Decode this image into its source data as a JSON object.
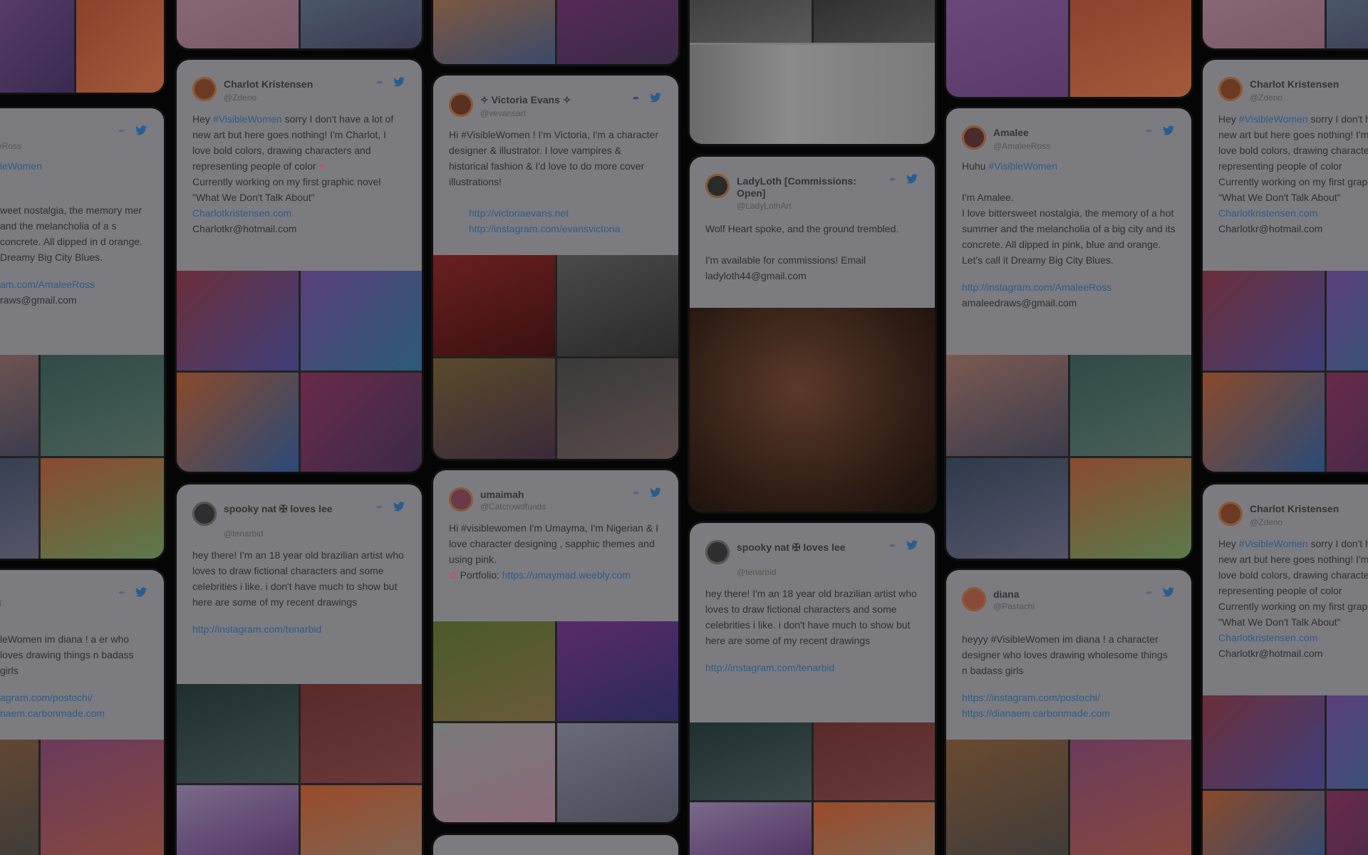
{
  "cards": {
    "charlot": {
      "name": "Charlot Kristensen",
      "handle": "@Zdeno",
      "lines": [
        "Hey",
        "#VisibleWomen",
        "sorry I don't have a lot of new art but here goes nothing! I'm Charlot, I love bold colors, drawing characters and representing people of color",
        "Currently working on my first graphic novel \"What We Don't Talk About\""
      ],
      "link": "Charlotkristensen.com",
      "email": "Charlotkr@hotmail.com"
    },
    "victoria": {
      "name": "✧ Victoria Evans ✧",
      "handle": "@vevansart",
      "text": "Hi #VisibleWomen ! I'm Victoria, I'm a character designer & illustrator. I love vampires & historical fashion & I'd love to do more cover illustrations!",
      "link1": "http://victoriaevans.net",
      "link2": "http://instagram.com/evansvictoria"
    },
    "ladyloth": {
      "name": "LadyLoth [Commissions: Open]",
      "handle": "@LadyLothArt",
      "text1": "Wolf Heart spoke, and the ground trembled.",
      "text2": "I'm available for commissions! Email ladyloth44@gmail.com"
    },
    "amalee": {
      "name": "Amalee",
      "handle": "@AmaleeRoss",
      "greeting": "Huhu",
      "tag": "#VisibleWomen",
      "intro": "I'm Amalee.",
      "text": "I love bittersweet nostalgia, the memory of a hot summer and the melancholia of a big city and its concrete. All dipped in pink, blue and orange. Let's call it Dreamy Big City Blues.",
      "link": "http://instagram.com/AmaleeRoss",
      "email": "amaleedraws@gmail.com"
    },
    "spooky": {
      "name": "spooky nat ✠ loves lee",
      "handle": "@tenarbid",
      "text": "hey there! I'm an 18 year old brazilian artist who loves to draw fictional characters and some celebrities i like. i don't have much to show but here are some of my recent drawings",
      "link": "http://instagram.com/tenarbid"
    },
    "umaimah": {
      "name": "umaimah",
      "handle": "@Catcrowdfunds",
      "text": "Hi #visiblewomen I'm Umayma, I'm Nigerian & I love character designing , sapphic themes and using pink.",
      "portfolio_label": "Portfolio:",
      "portfolio": "https://umaymad.weebly.com"
    },
    "diana": {
      "name": "diana",
      "handle": "@Pastachi",
      "text": "heyyy #VisibleWomen im diana ! a character designer who loves drawing wholesome things n badass girls",
      "link1": "https://instagram.com/postochi/",
      "link2": "https://dianaem.carbonmade.com"
    },
    "amalee_left": {
      "name": "ee",
      "handle": "aleeRoss",
      "tag": "leWomen",
      "text": "weet nostalgia, the memory mer and the melancholia of a s concrete. All dipped in d orange. Dreamy Big City Blues.",
      "link": "am.com/AmaleeRoss",
      "email": "raws@gmail.com"
    },
    "diana_left": {
      "handle": "achi",
      "text": "leWomen im diana ! a er who loves drawing things n badass girls",
      "link1": "agram.com/postochi/",
      "link2": "naem.carbonmade.com"
    }
  },
  "colors": {
    "card_bg": "#7c7c80",
    "link": "#2f5a88",
    "background": "#050505"
  }
}
